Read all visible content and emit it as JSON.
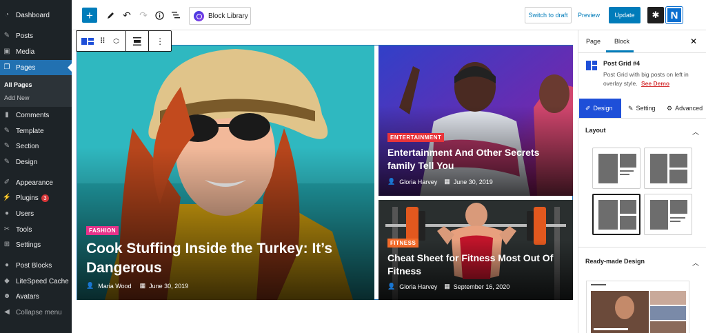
{
  "sidebar": {
    "items": [
      {
        "label": "Dashboard",
        "icon": "dashboard-icon"
      },
      {
        "label": "Posts",
        "icon": "pin-icon"
      },
      {
        "label": "Media",
        "icon": "media-icon"
      },
      {
        "label": "Pages",
        "icon": "pages-icon"
      },
      {
        "label": "Comments",
        "icon": "comment-icon"
      },
      {
        "label": "Template",
        "icon": "pin-icon"
      },
      {
        "label": "Section",
        "icon": "pin-icon"
      },
      {
        "label": "Design",
        "icon": "pin-icon"
      },
      {
        "label": "Appearance",
        "icon": "brush-icon"
      },
      {
        "label": "Plugins",
        "icon": "plug-icon",
        "badge": "3"
      },
      {
        "label": "Users",
        "icon": "users-icon"
      },
      {
        "label": "Tools",
        "icon": "wrench-icon"
      },
      {
        "label": "Settings",
        "icon": "settings-icon"
      },
      {
        "label": "Post Blocks",
        "icon": "circle-icon"
      },
      {
        "label": "LiteSpeed Cache",
        "icon": "diamond-icon"
      },
      {
        "label": "Avatars",
        "icon": "avatar-icon"
      },
      {
        "label": "Collapse menu",
        "icon": "collapse-icon"
      }
    ],
    "submenu": [
      "All Pages",
      "Add New"
    ]
  },
  "toolbar": {
    "block_library": "Block Library",
    "switch_draft": "Switch to draft",
    "preview": "Preview",
    "update": "Update",
    "logo_letter": "N"
  },
  "posts": [
    {
      "category": "FASHION",
      "category_color": "#e5338a",
      "title": "Cook Stuffing Inside the Turkey: It’s Dangerous",
      "author": "Maria Wood",
      "date": "June 30, 2019"
    },
    {
      "category": "ENTERTAINMENT",
      "category_color": "#e8343a",
      "title": "Entertainment And Other Secrets family Tell You",
      "author": "Gloria Harvey",
      "date": "June 30, 2019"
    },
    {
      "category": "FITNESS",
      "category_color": "#f26b2a",
      "title": "Cheat Sheet for Fitness Most Out Of Fitness",
      "author": "Gloria Harvey",
      "date": "September 16, 2020"
    }
  ],
  "panel": {
    "tabs": [
      "Page",
      "Block"
    ],
    "block_name": "Post Grid #4",
    "block_desc": "Post Grid with big posts on left in overlay style.",
    "see_demo": "See Demo",
    "subtabs": [
      "Design",
      "Setting",
      "Advanced"
    ],
    "layout_heading": "Layout",
    "ready_heading": "Ready-made Design"
  },
  "colors": {
    "accent": "#007cba",
    "active_nav": "#2271b1",
    "sidebar_bg": "#1d2327",
    "design_tab": "#1e4fd8",
    "see_demo": "#d63638"
  }
}
